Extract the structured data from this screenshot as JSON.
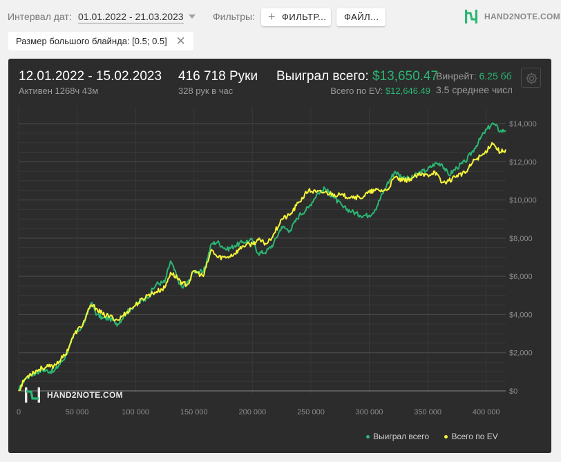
{
  "toolbar": {
    "interval_label": "Интервал дат:",
    "date_range": "01.01.2022 - 21.03.2023",
    "filters_label": "Фильтры:",
    "filter_button": "ФИЛЬТР...",
    "file_button": "ФАЙЛ...",
    "logo_text": "HAND2NOTE.COM"
  },
  "active_filter_chip": "Размер большого блайнда: [0.5; 0.5]",
  "stats": {
    "period": "12.01.2022 - 15.02.2023",
    "active_time": "Активен 1268ч 43м",
    "hands": "416 718 Руки",
    "hands_per_hour": "328 рук в час",
    "won_label": "Выиграл всего:",
    "won_value": "$13,650.47",
    "ev_label": "Всего по EV:",
    "ev_value": "$12,646.49",
    "winrate_label": "Винрейт:",
    "winrate_value": "6.25 бб",
    "avg_text": "3.5 среднее числ"
  },
  "watermark": "HAND2NOTE.COM",
  "colors": {
    "won": "#2bb673",
    "ev": "#f5f53a",
    "panel": "#2c2c2c",
    "brand": "#2bb673"
  },
  "chart_data": {
    "type": "line",
    "xlabel": "",
    "ylabel": "",
    "xlim": [
      0,
      416718
    ],
    "ylim": [
      0,
      14000
    ],
    "x_ticks": [
      0,
      50000,
      100000,
      150000,
      200000,
      250000,
      300000,
      350000,
      400000
    ],
    "x_tick_labels": [
      "0",
      "50 000",
      "100 000",
      "150 000",
      "200 000",
      "250 000",
      "300 000",
      "350 000",
      "400 000"
    ],
    "y_ticks": [
      0,
      2000,
      4000,
      6000,
      8000,
      10000,
      12000,
      14000
    ],
    "y_tick_labels": [
      "$0",
      "$2,000",
      "$4,000",
      "$6,000",
      "$8,000",
      "$10,000",
      "$12,000",
      "$14,000"
    ],
    "grid": true,
    "legend_position": "bottom-right",
    "x": [
      0,
      5000,
      10000,
      20000,
      30000,
      40000,
      48000,
      55000,
      62000,
      67000,
      72000,
      78000,
      85000,
      92000,
      96000,
      100000,
      110000,
      118000,
      125000,
      130000,
      138000,
      140000,
      145000,
      150000,
      158000,
      165000,
      170000,
      178000,
      185000,
      192000,
      200000,
      205000,
      212000,
      218000,
      225000,
      232000,
      240000,
      248000,
      255000,
      262000,
      270000,
      278000,
      285000,
      292000,
      300000,
      305000,
      315000,
      322000,
      328000,
      335000,
      342000,
      350000,
      356000,
      362000,
      368000,
      375000,
      382000,
      390000,
      398000,
      405000,
      408000,
      412000,
      416718
    ],
    "series": [
      {
        "name": "Выиграл всего",
        "color": "#2bb673",
        "values": [
          0,
          600,
          800,
          1100,
          1000,
          1800,
          3000,
          3400,
          4600,
          4000,
          3800,
          3800,
          3500,
          4100,
          4300,
          4500,
          4900,
          5600,
          5700,
          6800,
          5600,
          5400,
          5700,
          6300,
          6200,
          7700,
          7800,
          7400,
          7600,
          7800,
          7900,
          7200,
          7300,
          7700,
          8600,
          8400,
          9200,
          9600,
          10300,
          10600,
          10100,
          9600,
          9400,
          9200,
          9200,
          9500,
          10800,
          11500,
          11200,
          11100,
          11400,
          11600,
          11900,
          11900,
          11300,
          11700,
          12000,
          12700,
          13500,
          14000,
          13900,
          13600,
          13650
        ]
      },
      {
        "name": "Всего по EV",
        "color": "#f5f53a",
        "values": [
          0,
          600,
          900,
          1200,
          1300,
          1900,
          3000,
          3500,
          4500,
          4300,
          4000,
          3900,
          3700,
          4100,
          4300,
          4500,
          5000,
          5200,
          5400,
          6200,
          5800,
          5600,
          5600,
          6300,
          6000,
          7400,
          7000,
          7000,
          7200,
          7600,
          7700,
          7900,
          7700,
          8200,
          9000,
          9200,
          9900,
          10500,
          10400,
          10400,
          10300,
          10200,
          10200,
          10100,
          10400,
          10500,
          10500,
          11200,
          11000,
          11100,
          11300,
          11300,
          11500,
          10900,
          11000,
          11300,
          11400,
          12100,
          12400,
          13000,
          12800,
          12500,
          12646
        ]
      }
    ]
  }
}
